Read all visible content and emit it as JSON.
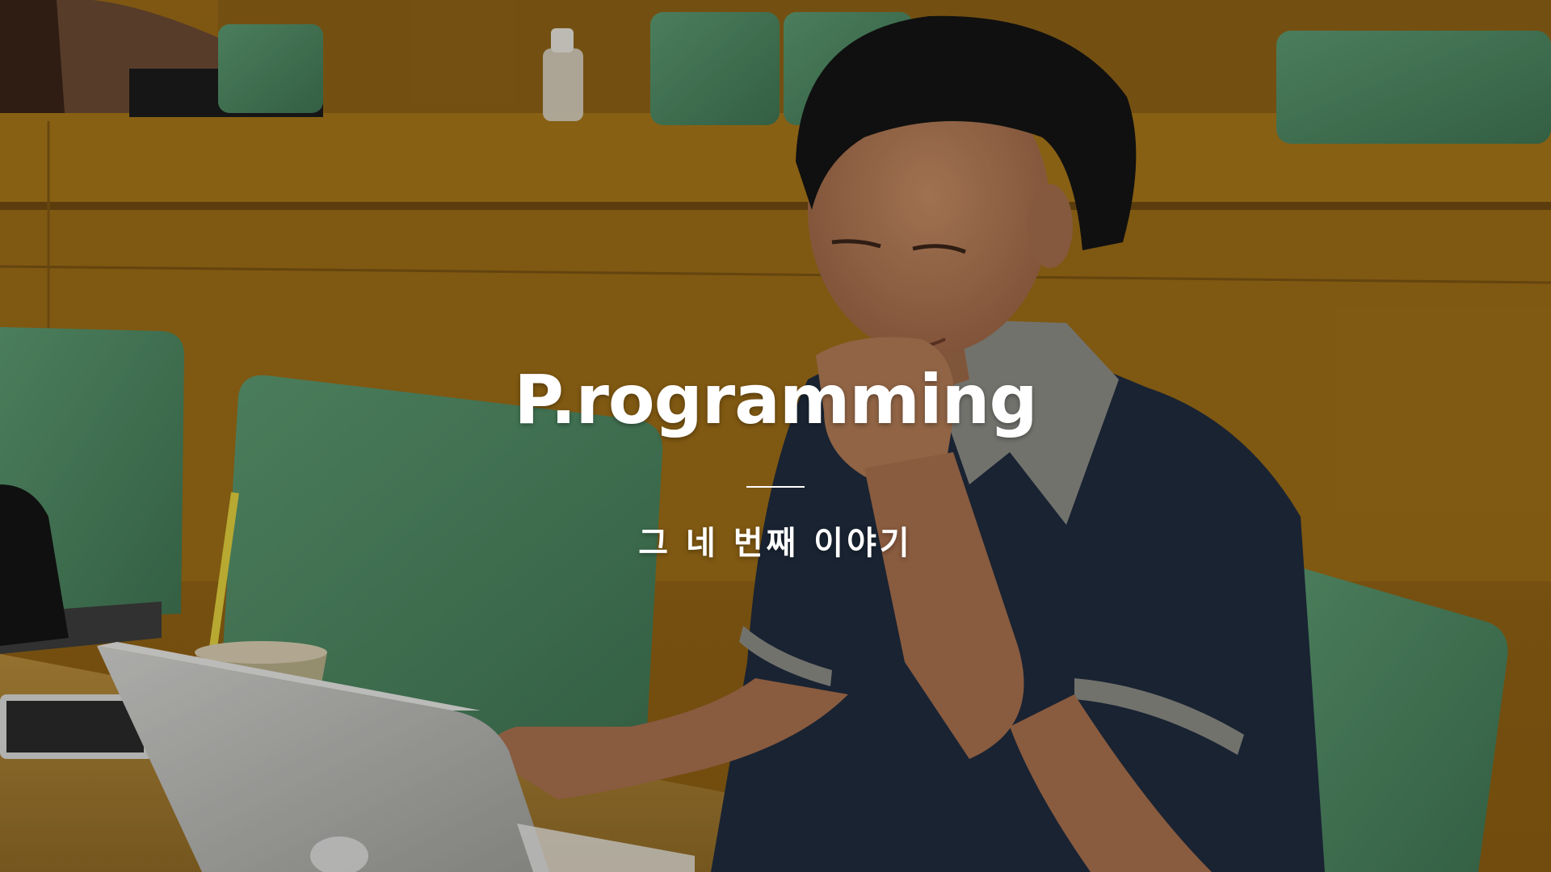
{
  "slide": {
    "title": "P.rogramming",
    "subtitle": "그 네 번째 이야기"
  },
  "photo": {
    "description_colors": {
      "wood": "#a9781e",
      "wood_dark": "#7a5514",
      "seat_green": "#4f8a62",
      "shirt_navy": "#1f2b3d",
      "collar_gray": "#8c8c86",
      "skin": "#b07a55",
      "hair": "#141414",
      "laptop_silver": "#b9b9b6"
    }
  }
}
